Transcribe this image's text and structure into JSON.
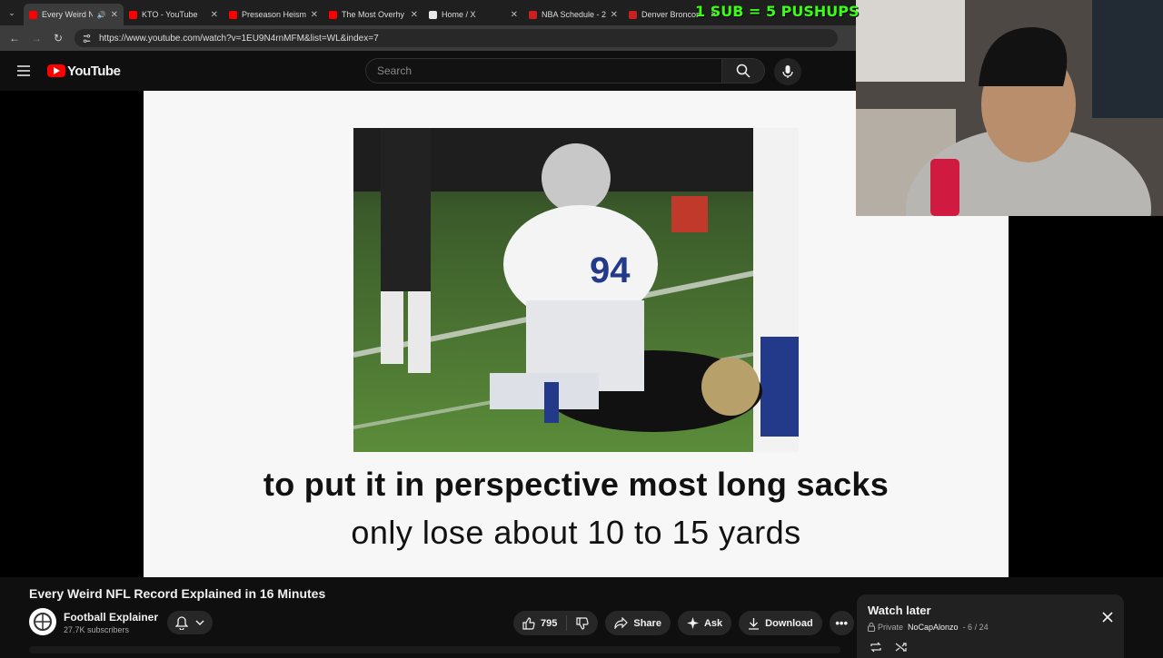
{
  "browser": {
    "tabs": [
      {
        "label": "Every Weird N",
        "favicon_color": "#ff0000",
        "active": true
      },
      {
        "label": "KTO - YouTube",
        "favicon_color": "#ff0000",
        "active": false
      },
      {
        "label": "Preseason Heism",
        "favicon_color": "#ff0000",
        "active": false
      },
      {
        "label": "The Most Overhy",
        "favicon_color": "#ff0000",
        "active": false
      },
      {
        "label": "Home / X",
        "favicon_color": "#e7e7e7",
        "active": false
      },
      {
        "label": "NBA Schedule - 2",
        "favicon_color": "#cc1f1f",
        "active": false
      },
      {
        "label": "Denver Broncos",
        "favicon_color": "#cc1f1f",
        "active": false
      }
    ],
    "url": "https://www.youtube.com/watch?v=1EU9N4rnMFM&list=WL&index=7"
  },
  "header": {
    "logo_text": "YouTube",
    "search_placeholder": "Search"
  },
  "stream_overlay": {
    "text": "1 SUB = 5 PUSHUPS"
  },
  "video": {
    "caption_line1": "to put it in perspective most long sacks",
    "caption_line2": "only lose about 10 to 15 yards",
    "title": "Every Weird NFL Record Explained in 16 Minutes"
  },
  "channel": {
    "name": "Football Explainer",
    "subscribers": "27.7K subscribers"
  },
  "actions": {
    "like_count": "795",
    "share_label": "Share",
    "ask_label": "Ask",
    "download_label": "Download"
  },
  "watch_later": {
    "title": "Watch later",
    "privacy": "Private",
    "owner": "NoCapAlonzo",
    "position": "- 6 / 24"
  },
  "colors": {
    "brand_red": "#ff0000",
    "overlay_green": "#39ff14",
    "background": "#0f0f0f"
  }
}
